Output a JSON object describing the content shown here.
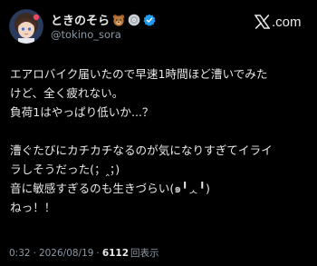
{
  "colors": {
    "background": "#000000",
    "text": "#e7e9ea",
    "muted": "#8b98a5",
    "verified": "#1d9bf0"
  },
  "author": {
    "display_name": "ときのそら",
    "handle": "@tokino_sora",
    "badges": [
      "bear-emoji-icon",
      "disc-emoji-icon",
      "verified-badge-icon"
    ]
  },
  "brand": {
    "logo_icon": "x-logo-icon",
    "text": ".com"
  },
  "post": {
    "lines": [
      "エアロバイク届いたので早速1時間ほど漕いでみた",
      "けど、全く疲れない。",
      "負荷1はやっぱり低いか...？",
      "",
      "漕ぐたびにカチカチなるのが気になりすぎてイライ",
      "ラしそうだった(；‸；)",
      "音に敏感すぎるのも生きづらい(๑╹ᆺ╹)",
      "ねっ！！"
    ]
  },
  "meta": {
    "time": "0:32",
    "date": "2026/08/19",
    "views": "6112",
    "views_label": "回表示",
    "separator": "·"
  }
}
